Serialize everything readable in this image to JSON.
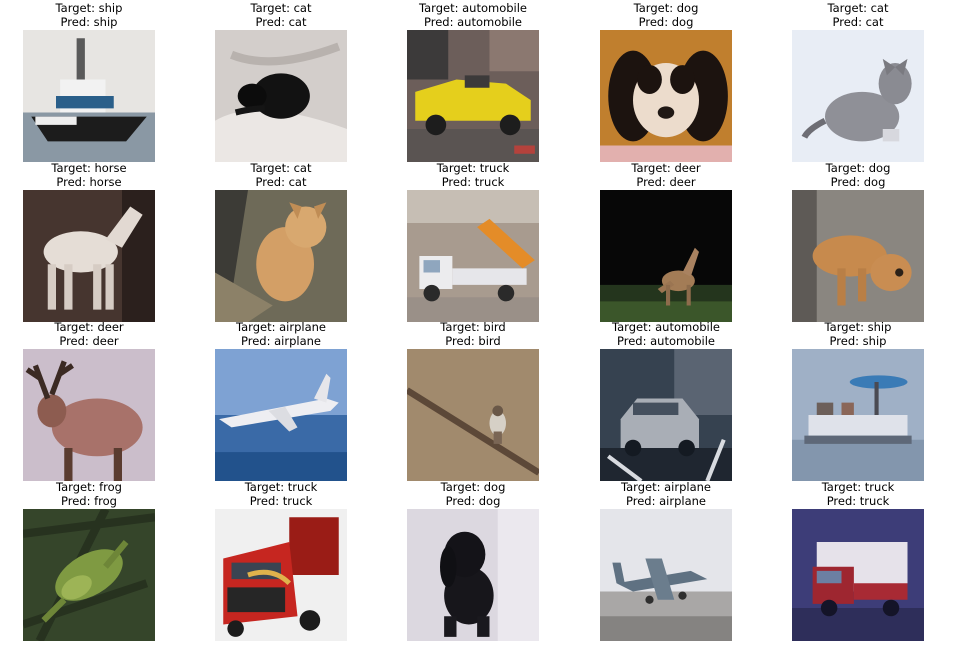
{
  "grid": [
    {
      "target": "Target: ship",
      "pred": "Pred: ship",
      "subject": "tugboat on water",
      "palette": [
        "#e7e5e2",
        "#5a6e80",
        "#1c1c1c",
        "#f4f4f4"
      ]
    },
    {
      "target": "Target: cat",
      "pred": "Pred: cat",
      "subject": "black cat on white blanket",
      "palette": [
        "#cfcac8",
        "#e6e2e0",
        "#111111",
        "#9c9794"
      ]
    },
    {
      "target": "Target: automobile",
      "pred": "Pred: automobile",
      "subject": "yellow convertible car",
      "palette": [
        "#7f6a62",
        "#5b5350",
        "#e8d21a",
        "#2c2a2a"
      ]
    },
    {
      "target": "Target: dog",
      "pred": "Pred: dog",
      "subject": "cavalier spaniel puppy",
      "palette": [
        "#c2802f",
        "#e9d3c0",
        "#1d1410",
        "#f4eeea"
      ]
    },
    {
      "target": "Target: cat",
      "pred": "Pred: cat",
      "subject": "grey cat on white",
      "palette": [
        "#e6ebf3",
        "#f4f6fa",
        "#8e8f96",
        "#6d6d74"
      ]
    },
    {
      "target": "Target: horse",
      "pred": "Pred: horse",
      "subject": "white horse",
      "palette": [
        "#4e3a36",
        "#2f2421",
        "#e4ddd7",
        "#6b5750"
      ]
    },
    {
      "target": "Target: cat",
      "pred": "Pred: cat",
      "subject": "ginger cat",
      "palette": [
        "#51504a",
        "#6f6a56",
        "#d5a36a",
        "#8f7a5e"
      ]
    },
    {
      "target": "Target: truck",
      "pred": "Pred: truck",
      "subject": "dump truck orange bed",
      "palette": [
        "#a79a8e",
        "#c9c4bf",
        "#e58f2a",
        "#e8e8ea"
      ]
    },
    {
      "target": "Target: deer",
      "pred": "Pred: deer",
      "subject": "deer at night",
      "palette": [
        "#0a0a0a",
        "#0d1a0b",
        "#a8805a",
        "#3d5a2c"
      ]
    },
    {
      "target": "Target: dog",
      "pred": "Pred: dog",
      "subject": "brown dog",
      "palette": [
        "#7f7d79",
        "#98928b",
        "#c98a4e",
        "#5f5b57"
      ]
    },
    {
      "target": "Target: deer",
      "pred": "Pred: deer",
      "subject": "antlered deer",
      "palette": [
        "#cdbfd0",
        "#b89aa0",
        "#8a5a4e",
        "#3a2a24"
      ]
    },
    {
      "target": "Target: airplane",
      "pred": "Pred: airplane",
      "subject": "white airliner in sky",
      "palette": [
        "#7ea4d6",
        "#3e6fae",
        "#f0f0f3",
        "#22548e"
      ]
    },
    {
      "target": "Target: bird",
      "pred": "Pred: bird",
      "subject": "bird on branch",
      "palette": [
        "#a08a6e",
        "#b29a7e",
        "#5c4a3a",
        "#dcd6cc"
      ]
    },
    {
      "target": "Target: automobile",
      "pred": "Pred: automobile",
      "subject": "silver suv",
      "palette": [
        "#3b4756",
        "#8e95a0",
        "#c9ccd2",
        "#1c232d"
      ]
    },
    {
      "target": "Target: ship",
      "pred": "Pred: ship",
      "subject": "pontoon boat",
      "palette": [
        "#8fa3bd",
        "#a8b8cd",
        "#3a7bb6",
        "#e4e6ec"
      ]
    },
    {
      "target": "Target: frog",
      "pred": "Pred: frog",
      "subject": "green frog",
      "palette": [
        "#3c4a2a",
        "#5a7030",
        "#8aa24a",
        "#2c3a24"
      ]
    },
    {
      "target": "Target: truck",
      "pred": "Pred: truck",
      "subject": "red semi truck",
      "palette": [
        "#f1f1f1",
        "#c8241c",
        "#2a2a2a",
        "#d9b054"
      ]
    },
    {
      "target": "Target: dog",
      "pred": "Pred: dog",
      "subject": "black dog",
      "palette": [
        "#dad6df",
        "#ece9ef",
        "#141318",
        "#5e5a62"
      ]
    },
    {
      "target": "Target: airplane",
      "pred": "Pred: airplane",
      "subject": "small plane on runway",
      "palette": [
        "#d9dae0",
        "#e8e9ee",
        "#5e7080",
        "#8f8c8a"
      ]
    },
    {
      "target": "Target: truck",
      "pred": "Pred: truck",
      "subject": "red truck blue background",
      "palette": [
        "#3c3c76",
        "#5a5a92",
        "#a02830",
        "#e8e4ea"
      ]
    }
  ]
}
